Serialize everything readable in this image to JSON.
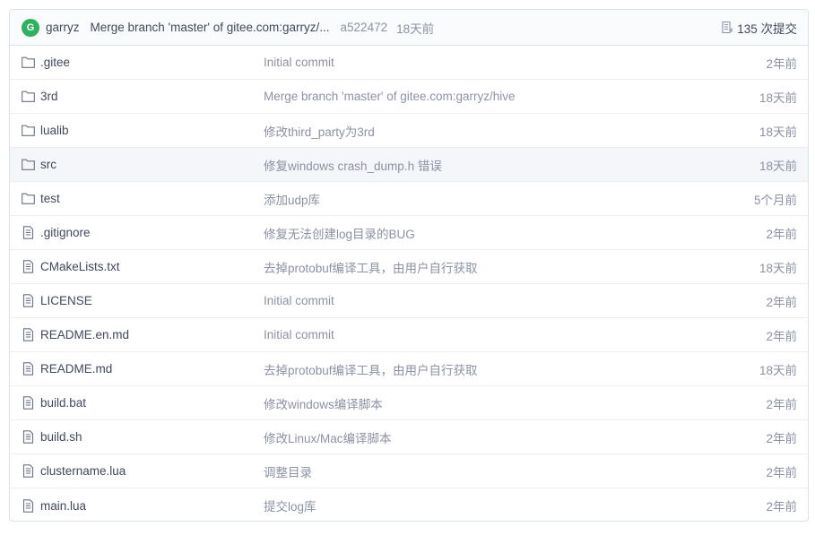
{
  "header": {
    "avatar_letter": "G",
    "author": "garryz",
    "message": "Merge branch 'master' of gitee.com:garryz/...",
    "sha": "a522472",
    "time": "18天前",
    "commits": "135 次提交",
    "avatar_color": "#2fb25f"
  },
  "files": [
    {
      "name": ".gitee",
      "type": "folder",
      "commit": "Initial commit",
      "time": "2年前"
    },
    {
      "name": "3rd",
      "type": "folder",
      "commit": "Merge branch 'master' of gitee.com:garryz/hive",
      "time": "18天前"
    },
    {
      "name": "lualib",
      "type": "folder",
      "commit": "修改third_party为3rd",
      "time": "18天前"
    },
    {
      "name": "src",
      "type": "folder",
      "commit": "修复windows crash_dump.h 错误",
      "time": "18天前",
      "hover": true
    },
    {
      "name": "test",
      "type": "folder",
      "commit": "添加udp库",
      "time": "5个月前"
    },
    {
      "name": ".gitignore",
      "type": "file",
      "commit": "修复无法创建log目录的BUG",
      "time": "2年前"
    },
    {
      "name": "CMakeLists.txt",
      "type": "file",
      "commit": "去掉protobuf编译工具，由用户自行获取",
      "time": "18天前"
    },
    {
      "name": "LICENSE",
      "type": "file",
      "commit": "Initial commit",
      "time": "2年前"
    },
    {
      "name": "README.en.md",
      "type": "file",
      "commit": "Initial commit",
      "time": "2年前"
    },
    {
      "name": "README.md",
      "type": "file",
      "commit": "去掉protobuf编译工具，由用户自行获取",
      "time": "18天前"
    },
    {
      "name": "build.bat",
      "type": "file",
      "commit": "修改windows编译脚本",
      "time": "2年前"
    },
    {
      "name": "build.sh",
      "type": "file",
      "commit": "修改Linux/Mac编译脚本",
      "time": "2年前"
    },
    {
      "name": "clustername.lua",
      "type": "file",
      "commit": "调整目录",
      "time": "2年前"
    },
    {
      "name": "main.lua",
      "type": "file",
      "commit": "提交log库",
      "time": "2年前"
    }
  ]
}
